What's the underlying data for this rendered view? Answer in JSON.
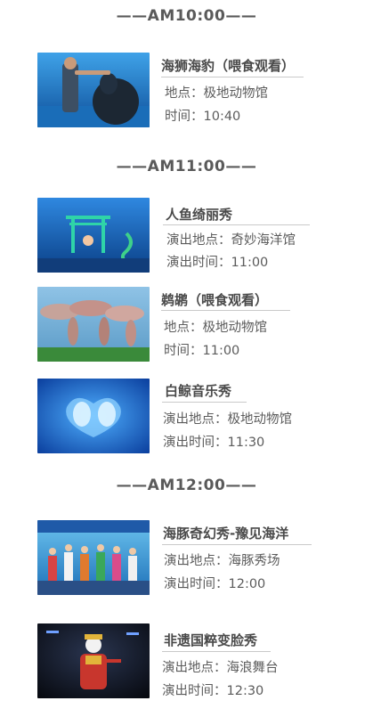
{
  "sections": [
    {
      "time": "——AM10:00——",
      "shows": [
        {
          "title": "海狮海豹（喂食观看）",
          "place_label": "地点：",
          "place": "极地动物馆",
          "time_label": "时间：",
          "time": "10:40",
          "image": "sea-lion-feeding"
        }
      ]
    },
    {
      "time": "——AM11:00——",
      "shows": [
        {
          "title": "人鱼绮丽秀",
          "place_label": "演出地点：",
          "place": "奇妙海洋馆",
          "time_label": "演出时间：",
          "time": "11:00",
          "image": "mermaid-show"
        },
        {
          "title": "鹈鹕（喂食观看）",
          "place_label": "地点：",
          "place": "极地动物馆",
          "time_label": "时间：",
          "time": "11:00",
          "image": "pelican-feeding"
        },
        {
          "title": "白鲸音乐秀",
          "place_label": "演出地点：",
          "place": "极地动物馆",
          "time_label": "演出时间：",
          "time": "11:30",
          "image": "beluga-music-show"
        }
      ]
    },
    {
      "time": "——AM12:00——",
      "shows": [
        {
          "title": "海豚奇幻秀-豫见海洋",
          "place_label": "演出地点：",
          "place": "海豚秀场",
          "time_label": "演出时间：",
          "time": "12:00",
          "image": "dolphin-fantasy-show"
        },
        {
          "title": "非遗国粹变脸秀",
          "place_label": "演出地点：",
          "place": "海浪舞台",
          "time_label": "演出时间：",
          "time": "12:30",
          "image": "face-changing-opera"
        }
      ]
    }
  ],
  "colors": {
    "text": "#555555",
    "title": "#4a4a4a",
    "rule": "#c9c9c9",
    "water": "#1f6fd6"
  }
}
